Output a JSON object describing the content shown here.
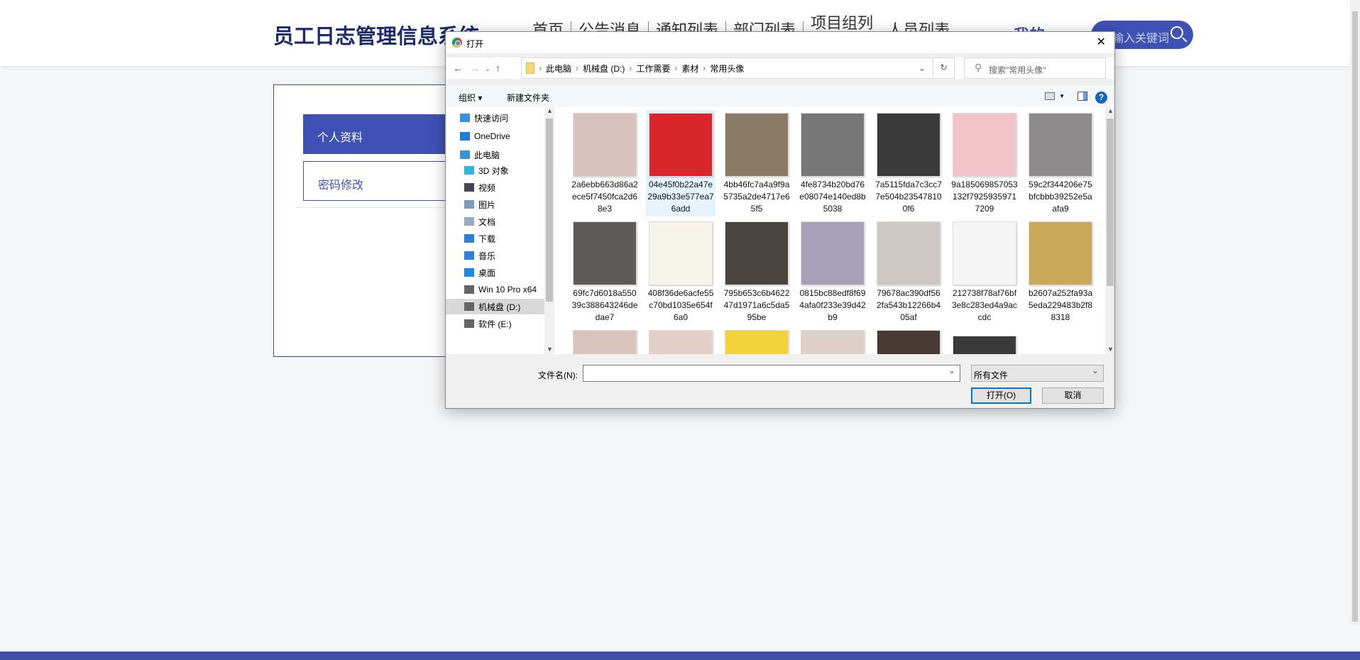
{
  "site": {
    "title": "员工日志管理信息系统",
    "nav": [
      "首页",
      "公告消息",
      "通知列表",
      "部门列表",
      "项目组列",
      "人员列表"
    ],
    "mine": "我的",
    "search_placeholder": "输入关键词"
  },
  "sidebar": {
    "items": [
      "个人资料",
      "密码修改"
    ]
  },
  "dialog": {
    "title": "打开",
    "breadcrumb": [
      "此电脑",
      "机械盘 (D:)",
      "工作需要",
      "素材",
      "常用头像"
    ],
    "search_placeholder": "搜索\"常用头像\"",
    "toolbar": {
      "organize": "组织 ▾",
      "new_folder": "新建文件夹"
    },
    "nav_items": [
      {
        "label": "快速访问",
        "icon": "star-icon"
      },
      {
        "label": "OneDrive",
        "icon": "cloud-icon"
      },
      {
        "label": "此电脑",
        "icon": "computer-icon"
      },
      {
        "label": "3D 对象",
        "icon": "cube-icon"
      },
      {
        "label": "视频",
        "icon": "video-icon"
      },
      {
        "label": "图片",
        "icon": "picture-icon"
      },
      {
        "label": "文档",
        "icon": "document-icon"
      },
      {
        "label": "下载",
        "icon": "download-icon"
      },
      {
        "label": "音乐",
        "icon": "music-icon"
      },
      {
        "label": "桌面",
        "icon": "desktop-icon"
      },
      {
        "label": "Win 10 Pro x64",
        "icon": "drive-icon"
      },
      {
        "label": "机械盘 (D:)",
        "icon": "drive-icon"
      },
      {
        "label": "软件 (E:)",
        "icon": "drive-icon"
      }
    ],
    "files": [
      {
        "name": "2a6ebb663d86a2ece5f7450fca2d68e3",
        "color": "#d8c2bd"
      },
      {
        "name": "04e45f0b22a47e29a9b33e577ea76add",
        "color": "#d8262b"
      },
      {
        "name": "4bb46fc7a4a9f9a5735a2de4717e65f5",
        "color": "#8a7a66"
      },
      {
        "name": "4fe8734b20bd76e08074e140ed8b5038",
        "color": "#777777"
      },
      {
        "name": "7a5115fda7c3cc77e504b235478100f6",
        "color": "#3a3a3a"
      },
      {
        "name": "9a185069857053132f79259359717209",
        "color": "#f0c4c8"
      },
      {
        "name": "59c2f344206e75bfcbbb39252e5aafa9",
        "color": "#8f8a8c"
      },
      {
        "name": "69fc7d6018a55039c388643246dedae7",
        "color": "#5e5a58"
      },
      {
        "name": "408f36de6acfe55c70bd1035e654f6a0",
        "color": "#f5f3ea"
      },
      {
        "name": "795b653c6b462247d1971a6c5da595be",
        "color": "#4a4440"
      },
      {
        "name": "0815bc88edf8f694afa0f233e39d42b9",
        "color": "#a8a0b8"
      },
      {
        "name": "79678ac390df562fa543b12266b405af",
        "color": "#cfc7c4"
      },
      {
        "name": "212738f78af76bf3e8c283ed4a9accdc",
        "color": "#f5f5f5"
      },
      {
        "name": "b2607a252fa93a5eda229483b2f88318",
        "color": "#c9a95a"
      }
    ],
    "partial_thumbs": [
      "#d9c3bb",
      "#e3cfc6",
      "#f3d23a",
      "#dcd0c8",
      "#4a3a36",
      "#3a3a3a"
    ],
    "filename_label": "文件名(N):",
    "filename_value": "",
    "filter": "所有文件",
    "open_button": "打开(O)",
    "cancel_button": "取消"
  }
}
